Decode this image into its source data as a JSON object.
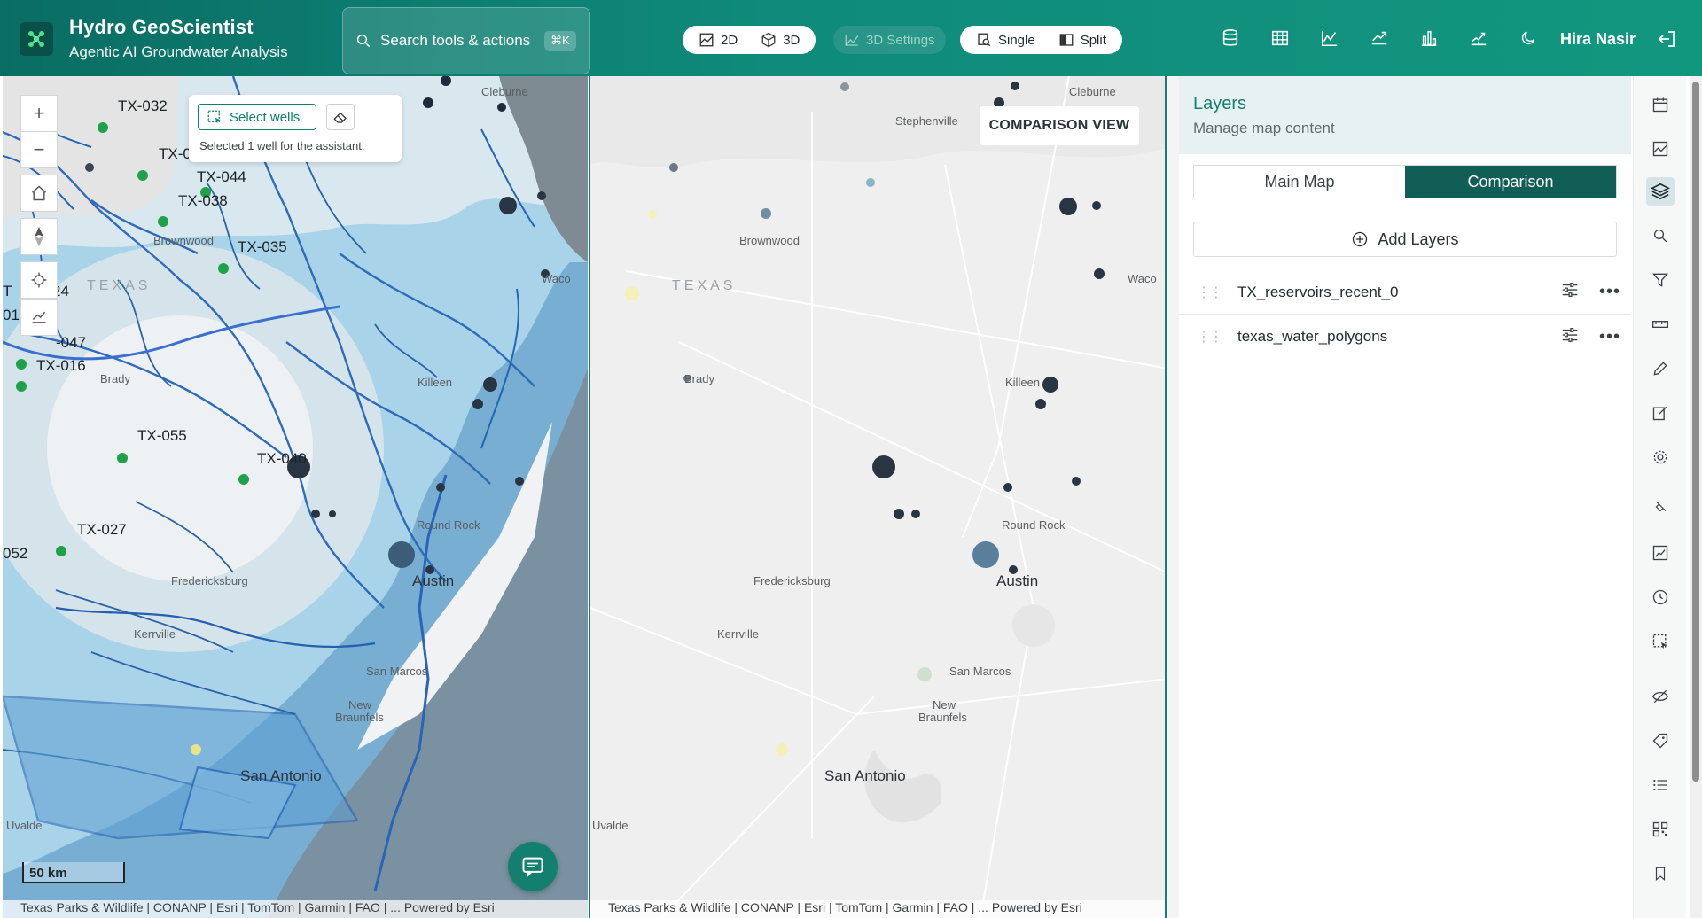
{
  "app": {
    "title": "Hydro GeoScientist",
    "subtitle": "Agentic AI Groundwater Analysis",
    "user": "Hira Nasir"
  },
  "search": {
    "label": "Search tools & actions",
    "shortcut": "⌘K"
  },
  "view_toggle": {
    "two_d": "2D",
    "three_d": "3D",
    "settings_3d": "3D Settings"
  },
  "layout_toggle": {
    "single": "Single",
    "split": "Split"
  },
  "header_icons": [
    "database-icon",
    "table-icon",
    "line-chart-icon",
    "trend-icon",
    "bar-chart-icon",
    "forecast-icon",
    "moon-icon"
  ],
  "map_left": {
    "select_wells_label": "Select wells",
    "selection_note": "Selected 1 well for the assistant.",
    "scale": "50 km",
    "attribution": "Texas Parks & Wildlife | CONANP | Esri | TomTom | Garmin | FAO | ...   Powered by Esri",
    "places": {
      "cleburne": "Cleburne",
      "stephenville": "Stephenville",
      "brownwood": "Brownwood",
      "texas": "TEXAS",
      "waco": "Waco",
      "brady": "Brady",
      "killeen": "Killeen",
      "round_rock": "Round Rock",
      "fredericksburg": "Fredericksburg",
      "austin": "Austin",
      "kerrville": "Kerrville",
      "san_marcos": "San Marcos",
      "new": "New",
      "braunfels": "Braunfels",
      "san_antonio": "San Antonio",
      "uvalde": "Uvalde"
    },
    "well_labels": {
      "w032": "TX-032",
      "w0x": "TX-0",
      "w044": "TX-044",
      "w038": "TX-038",
      "w035": "TX-035",
      "w24": "24",
      "w047": "-047",
      "w016": "TX-016",
      "w055": "TX-055",
      "w040": "TX-040",
      "w027": "TX-027",
      "w052": "052",
      "w011": "01",
      "wT": "T"
    }
  },
  "map_right": {
    "badge": "COMPARISON VIEW",
    "attribution": "Texas Parks & Wildlife | CONANP | Esri | TomTom | Garmin | FAO | ...   Powered by Esri"
  },
  "layers_panel": {
    "title": "Layers",
    "subtitle": "Manage map content",
    "tabs": [
      "Main Map",
      "Comparison"
    ],
    "active_tab": "Comparison",
    "add_label": "Add Layers",
    "layers": [
      {
        "name": "TX_reservoirs_recent_0"
      },
      {
        "name": "texas_water_polygons"
      }
    ]
  },
  "rail_icons": [
    "calendar-icon",
    "image-analysis-icon",
    "layers-icon",
    "search-icon",
    "filter-icon",
    "measure-icon",
    "pencil-icon",
    "edit-note-icon",
    "settings-icon",
    "pin-icon",
    "chart-frame-icon",
    "clock-icon",
    "select-box-icon",
    "visibility-icon",
    "tag-icon",
    "list-icon",
    "qr-icon",
    "bookmark-icon"
  ],
  "colors": {
    "primary": "#13806f",
    "header_start": "#0a6d63",
    "header_end": "#12977f",
    "water": "#2f8fd4",
    "well_green": "#1ea34a",
    "reservoir_dark": "#2a3544"
  }
}
